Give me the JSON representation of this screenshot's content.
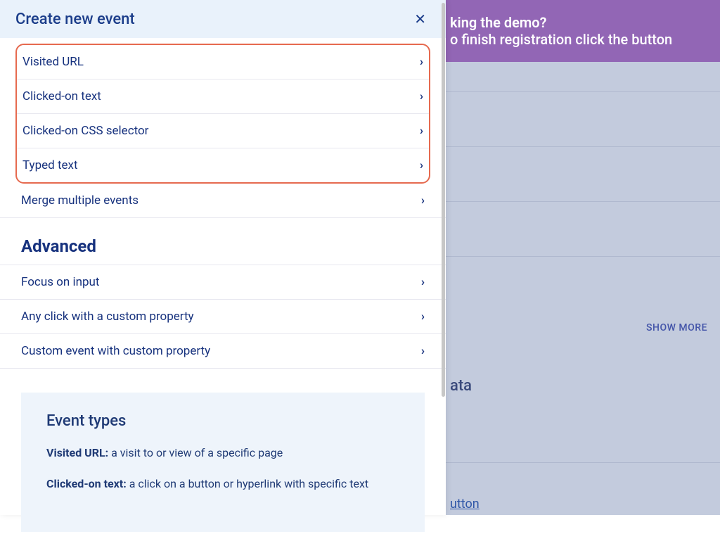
{
  "background": {
    "banner_line1": "king the demo?",
    "banner_line2": "o finish registration click the button",
    "show_more": "SHOW MORE",
    "section_ata": "ata",
    "button_label": "utton"
  },
  "panel": {
    "title": "Create new event",
    "primary_events": [
      {
        "label": "Visited URL"
      },
      {
        "label": "Clicked-on text"
      },
      {
        "label": "Clicked-on CSS selector"
      },
      {
        "label": "Typed text"
      }
    ],
    "merge_label": "Merge multiple events",
    "advanced_heading": "Advanced",
    "advanced_events": [
      {
        "label": "Focus on input"
      },
      {
        "label": "Any click with a custom property"
      },
      {
        "label": "Custom event with custom property"
      }
    ],
    "info": {
      "heading": "Event types",
      "defs": [
        {
          "term": "Visited URL:",
          "desc": " a visit to or view of a specific page"
        },
        {
          "term": "Clicked-on text:",
          "desc": " a click on a button or hyperlink with specific text"
        }
      ]
    }
  }
}
